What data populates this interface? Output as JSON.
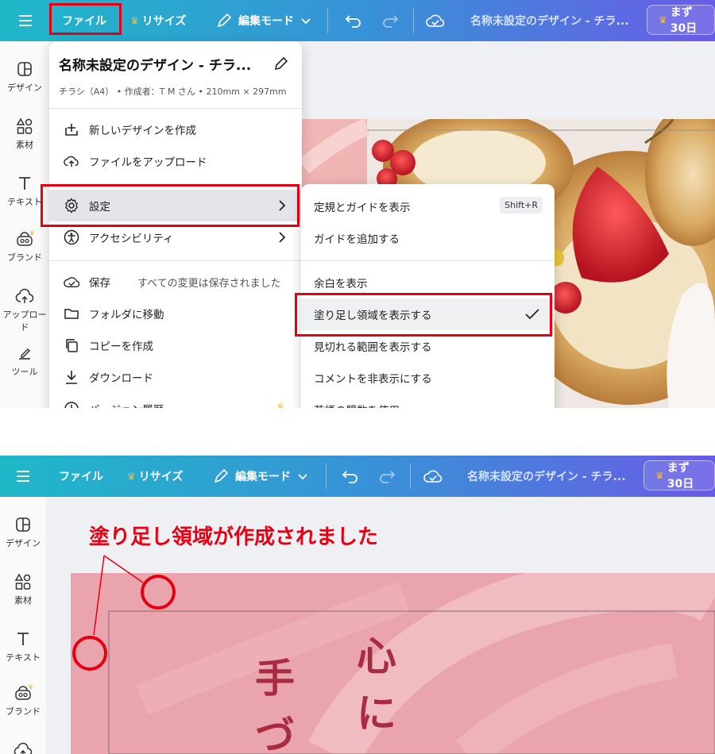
{
  "topbar": {
    "file": "ファイル",
    "resize": "リサイズ",
    "edit_mode": "編集モード",
    "doc_title": "名称未設定のデザイン - チラ...",
    "trial": "まず30日"
  },
  "sidebar": {
    "items": [
      {
        "label": "デザイン",
        "icon": "layout-icon"
      },
      {
        "label": "素材",
        "icon": "shapes-icon"
      },
      {
        "label": "テキスト",
        "icon": "text-icon"
      },
      {
        "label": "ブランド",
        "icon": "brand-icon"
      },
      {
        "label": "アップロード",
        "icon": "upload-cloud-icon"
      },
      {
        "label": "ツール",
        "icon": "tools-icon"
      }
    ]
  },
  "file_menu": {
    "title": "名称未設定のデザイン - チラ...",
    "meta": "チラシ（A4） • 作成者：T M さん • 210mm × 297mm",
    "items": [
      {
        "label": "新しいデザインを作成",
        "icon": "plus-page-icon"
      },
      {
        "label": "ファイルをアップロード",
        "icon": "upload-cloud-icon"
      },
      {
        "label": "設定",
        "icon": "gear-icon"
      },
      {
        "label": "アクセシビリティ",
        "icon": "accessibility-icon"
      },
      {
        "label": "保存",
        "icon": "cloud-check-icon",
        "note": "すべての変更は保存されました"
      },
      {
        "label": "フォルダに移動",
        "icon": "folder-icon"
      },
      {
        "label": "コピーを作成",
        "icon": "copy-icon"
      },
      {
        "label": "ダウンロード",
        "icon": "download-icon"
      },
      {
        "label": "バージョン履歴",
        "icon": "history-icon"
      }
    ]
  },
  "settings_menu": {
    "items": [
      {
        "label": "定規とガイドを表示",
        "shortcut": "Shift+R"
      },
      {
        "label": "ガイドを追加する"
      },
      {
        "label": "余白を表示"
      },
      {
        "label": "塗り足し領域を表示する",
        "checked": true
      },
      {
        "label": "見切れる範囲を表示する"
      },
      {
        "label": "コメントを非表示にする"
      },
      {
        "label": "英語の盟数を使用"
      }
    ]
  },
  "annotation": {
    "text": "塗り足し領域が作成されました"
  },
  "canvas": {
    "vertical_text": [
      "手",
      "心",
      "づ",
      "に"
    ]
  },
  "colors": {
    "accent_red": "#e60012",
    "topbar_start": "#1fb8c9",
    "topbar_end": "#6a5be6",
    "canvas_pink": "#eaa4ad"
  }
}
